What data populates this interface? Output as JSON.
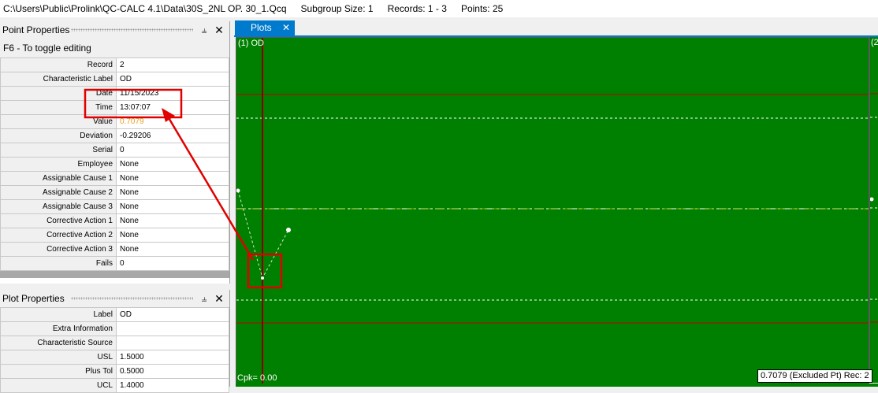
{
  "titlebar": {
    "path": "C:\\Users\\Public\\Prolink\\QC-CALC 4.1\\Data\\30S_2NL OP. 30_1.Qcq",
    "subgroup": "Subgroup Size: 1",
    "records": "Records: 1 - 3",
    "points": "Points: 25"
  },
  "point_properties": {
    "title": "Point Properties",
    "toggle_hint": "F6 - To toggle editing",
    "rows": [
      {
        "label": "Record",
        "value": "2"
      },
      {
        "label": "Characteristic Label",
        "value": "OD"
      },
      {
        "label": "Date",
        "value": "11/15/2023"
      },
      {
        "label": "Time",
        "value": "13:07:07"
      },
      {
        "label": "Value",
        "value": "0.7079"
      },
      {
        "label": "Deviation",
        "value": "-0.29206"
      },
      {
        "label": "Serial",
        "value": "0"
      },
      {
        "label": "Employee",
        "value": "None"
      },
      {
        "label": "Assignable Cause 1",
        "value": "None"
      },
      {
        "label": "Assignable Cause 2",
        "value": "None"
      },
      {
        "label": "Assignable Cause 3",
        "value": "None"
      },
      {
        "label": "Corrective Action 1",
        "value": "None"
      },
      {
        "label": "Corrective Action 2",
        "value": "None"
      },
      {
        "label": "Corrective Action 3",
        "value": "None"
      },
      {
        "label": "Fails",
        "value": "0"
      }
    ]
  },
  "plot_properties": {
    "title": "Plot Properties",
    "rows": [
      {
        "label": "Label",
        "value": "OD"
      },
      {
        "label": "Extra Information",
        "value": ""
      },
      {
        "label": "Characteristic Source",
        "value": ""
      },
      {
        "label": "USL",
        "value": "1.5000"
      },
      {
        "label": "Plus Tol",
        "value": "0.5000"
      },
      {
        "label": "UCL",
        "value": "1.4000"
      }
    ]
  },
  "icons": {
    "pin": "pin-icon",
    "close": "close-icon"
  },
  "glyphs": {
    "pin": "⫨",
    "close": "✕"
  },
  "plots_tab": {
    "label": "Plots",
    "close": "✕"
  },
  "plot": {
    "title": "(1) OD",
    "title2": "(2",
    "cpk": "Cpk= 0.00",
    "readout": "0.7079 (Excluded Pt) Rec: 2"
  },
  "colors": {
    "plot_background": "#008000",
    "limit_line": "#c00000",
    "tab": "#007acc",
    "highlight": "#e00000",
    "value_text": "#e8a020"
  },
  "chart_data": {
    "type": "line",
    "title": "(1) OD",
    "x": [
      1,
      2,
      3
    ],
    "series": [
      {
        "values": [
          null,
          0.7079,
          null
        ]
      }
    ],
    "selected_record": 2
  }
}
